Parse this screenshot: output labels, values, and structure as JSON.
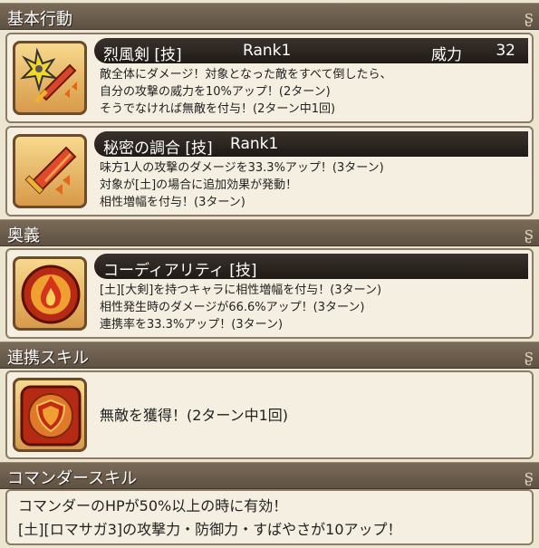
{
  "sections": {
    "basic": "基本行動",
    "ougi": "奥義",
    "link": "連携スキル",
    "commander": "コマンダースキル"
  },
  "skill1": {
    "name": "烈風剣 [技]",
    "rank": "Rank1",
    "power_label": "威力",
    "power_value": "32",
    "lines": [
      "敵全体にダメージ！対象となった敵をすべて倒したら、",
      "自分の攻撃の威力を10%アップ！(2ターン)",
      "そうでなければ無敵を付与！(2ターン中1回)"
    ]
  },
  "skill2": {
    "name": "秘密の調合 [技]",
    "rank": "Rank1",
    "lines": [
      "味方1人の攻撃のダメージを33.3%アップ！(3ターン)",
      "対象が[土]の場合に追加効果が発動！",
      "相性増幅を付与！(3ターン)"
    ]
  },
  "ougi": {
    "name": "コーディアリティ [技]",
    "lines": [
      "[土][大剣]を持つキャラに相性増幅を付与！(3ターン)",
      "相性発生時のダメージが66.6%アップ！(3ターン)",
      "連携率を33.3%アップ！(3ターン)"
    ]
  },
  "link_skill": {
    "text": "無敵を獲得！(2ターン中1回)"
  },
  "commander": {
    "lines": [
      "コマンダーのHPが50%以上の時に有効！",
      "[土][ロマサガ3]の攻撃力・防御力・すばやさが10アップ！"
    ]
  },
  "icons": {
    "skill1": "shuriken-sword-icon",
    "skill2": "flaming-sword-icon",
    "ougi": "earth-flame-icon",
    "link": "shield-icon"
  }
}
